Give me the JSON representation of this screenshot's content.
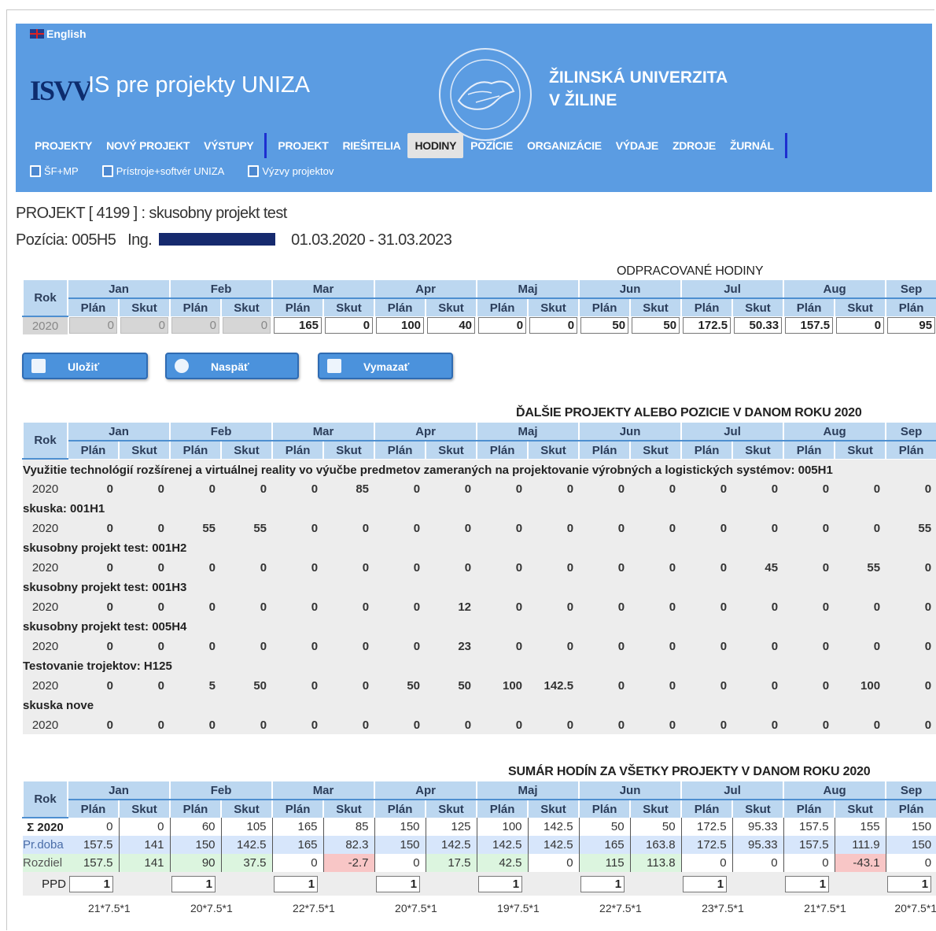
{
  "header": {
    "language": "English",
    "logo": "ISVV",
    "app_title": "IS pre projekty UNIZA",
    "university_line1": "ŽILINSKÁ UNIVERZITA",
    "university_line2": "V ŽILINE",
    "menu_main": [
      "PROJEKTY",
      "NOVÝ PROJEKT",
      "VÝSTUPY"
    ],
    "menu_project": [
      "PROJEKT",
      "RIEŠITELIA",
      "HODINY",
      "POZÍCIE",
      "ORGANIZÁCIE",
      "VÝDAJE",
      "ZDROJE",
      "ŽURNÁL"
    ],
    "active_tab": "HODINY",
    "submenu": [
      "ŠF+MP",
      "Prístroje+softvér UNIZA",
      "Výzvy projektov"
    ],
    "colors": {
      "header_bg": "#5b9ce2",
      "logo": "#0d2c6e",
      "separator": "#1d2fd0"
    }
  },
  "project": {
    "title": "PROJEKT [ 4199 ] : skusobny projekt test",
    "position_label": "Pozícia: 005H5",
    "person_title": "Ing.",
    "dates": "01.03.2020 - 31.03.2023"
  },
  "months": [
    "Jan",
    "Feb",
    "Mar",
    "Apr",
    "Maj",
    "Jun",
    "Jul",
    "Aug",
    "Sep"
  ],
  "sub_headers": {
    "plan": "Plán",
    "skut": "Skut",
    "rok": "Rok"
  },
  "hours": {
    "title": "ODPRACOVANÉ HODINY",
    "year": "2020",
    "values": [
      "0",
      "0",
      "0",
      "0",
      "165",
      "0",
      "100",
      "40",
      "0",
      "0",
      "50",
      "50",
      "172.5",
      "50.33",
      "157.5",
      "0",
      "95"
    ],
    "readonly_count": 4
  },
  "buttons": {
    "save": "Uložiť",
    "back": "Naspäť",
    "delete": "Vymazať"
  },
  "other": {
    "title": "ĎALŠIE PROJEKTY ALEBO POZICIE V DANOM ROKU 2020",
    "projects": [
      {
        "name": "Využitie technológií rozšírenej a virtuálnej reality vo výučbe predmetov zameraných na projektovanie výrobných a logistických systémov: 005H1",
        "year": "2020",
        "values": [
          "0",
          "0",
          "0",
          "0",
          "0",
          "85",
          "0",
          "0",
          "0",
          "0",
          "0",
          "0",
          "0",
          "0",
          "0",
          "0",
          "0"
        ]
      },
      {
        "name": "skuska: 001H1",
        "year": "2020",
        "values": [
          "0",
          "0",
          "55",
          "55",
          "0",
          "0",
          "0",
          "0",
          "0",
          "0",
          "0",
          "0",
          "0",
          "0",
          "0",
          "0",
          "55"
        ]
      },
      {
        "name": "skusobny projekt test: 001H2",
        "year": "2020",
        "values": [
          "0",
          "0",
          "0",
          "0",
          "0",
          "0",
          "0",
          "0",
          "0",
          "0",
          "0",
          "0",
          "0",
          "45",
          "0",
          "55",
          "0"
        ]
      },
      {
        "name": "skusobny projekt test: 001H3",
        "year": "2020",
        "values": [
          "0",
          "0",
          "0",
          "0",
          "0",
          "0",
          "0",
          "12",
          "0",
          "0",
          "0",
          "0",
          "0",
          "0",
          "0",
          "0",
          "0"
        ]
      },
      {
        "name": "skusobny projekt test: 005H4",
        "year": "2020",
        "values": [
          "0",
          "0",
          "0",
          "0",
          "0",
          "0",
          "0",
          "23",
          "0",
          "0",
          "0",
          "0",
          "0",
          "0",
          "0",
          "0",
          "0"
        ]
      },
      {
        "name": "Testovanie trojektov: H125",
        "year": "2020",
        "values": [
          "0",
          "0",
          "5",
          "50",
          "0",
          "0",
          "50",
          "50",
          "100",
          "142.5",
          "0",
          "0",
          "0",
          "0",
          "0",
          "100",
          "0"
        ]
      },
      {
        "name": "skuska nove",
        "year": "2020",
        "values": [
          "0",
          "0",
          "0",
          "0",
          "0",
          "0",
          "0",
          "0",
          "0",
          "0",
          "0",
          "0",
          "0",
          "0",
          "0",
          "0",
          "0"
        ]
      }
    ]
  },
  "summary": {
    "title": "SUMÁR HODÍN ZA VŠETKY PROJEKTY V DANOM ROKU 2020",
    "rows": [
      {
        "label": "Σ 2020",
        "values": [
          "0",
          "0",
          "60",
          "105",
          "165",
          "85",
          "150",
          "125",
          "100",
          "142.5",
          "50",
          "50",
          "172.5",
          "95.33",
          "157.5",
          "155",
          "150"
        ]
      },
      {
        "label": "Pr.doba",
        "values": [
          "157.5",
          "141",
          "150",
          "142.5",
          "165",
          "82.3",
          "150",
          "142.5",
          "142.5",
          "142.5",
          "165",
          "163.8",
          "172.5",
          "95.33",
          "157.5",
          "111.9",
          "150"
        ]
      },
      {
        "label": "Rozdiel",
        "values": [
          "157.5",
          "141",
          "90",
          "37.5",
          "0",
          "-2.7",
          "0",
          "17.5",
          "42.5",
          "0",
          "115",
          "113.8",
          "0",
          "0",
          "0",
          "-43.1",
          "0"
        ]
      }
    ],
    "ppd_label": "PPD",
    "ppd_values": [
      "1",
      "1",
      "1",
      "1",
      "1",
      "1",
      "1",
      "1",
      "1"
    ],
    "formulas": [
      "21*7.5*1",
      "20*7.5*1",
      "22*7.5*1",
      "20*7.5*1",
      "19*7.5*1",
      "22*7.5*1",
      "23*7.5*1",
      "21*7.5*1",
      "20*7.5*1"
    ]
  }
}
